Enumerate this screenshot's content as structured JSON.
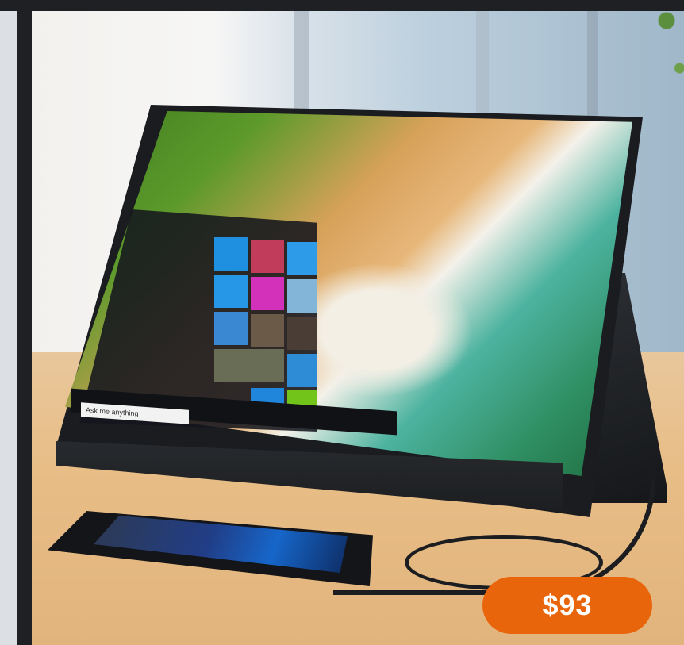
{
  "product": {
    "image_alt": "Portable monitor with phone connected by cable",
    "price": "$93"
  },
  "screen": {
    "search_placeholder": "Ask me anything"
  },
  "colors": {
    "price_badge": "#e8650b",
    "page_background": "#1f2023"
  }
}
